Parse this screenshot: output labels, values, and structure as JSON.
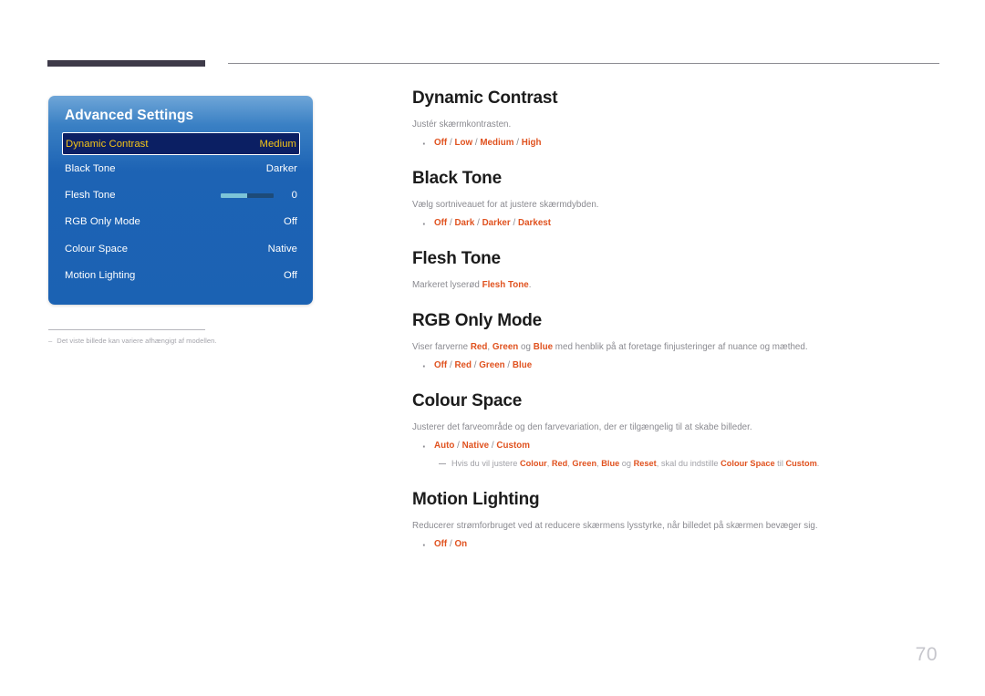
{
  "page": {
    "number": "70"
  },
  "osd": {
    "title": "Advanced Settings",
    "rows": [
      {
        "label": "Dynamic Contrast",
        "value": "Medium",
        "selected": true,
        "type": "value"
      },
      {
        "label": "Black Tone",
        "value": "Darker",
        "selected": false,
        "type": "value"
      },
      {
        "label": "Flesh Tone",
        "value": "0",
        "selected": false,
        "type": "slider",
        "slider_percent": 50
      },
      {
        "label": "RGB Only Mode",
        "value": "Off",
        "selected": false,
        "type": "value"
      },
      {
        "label": "Colour Space",
        "value": "Native",
        "selected": false,
        "type": "value"
      },
      {
        "label": "Motion Lighting",
        "value": "Off",
        "selected": false,
        "type": "value"
      }
    ]
  },
  "footnote": {
    "dash": "‒",
    "text": "Det viste billede kan variere afhængigt af modellen."
  },
  "sections": {
    "dynamic_contrast": {
      "heading": "Dynamic Contrast",
      "description": "Justér skærmkontrasten.",
      "options": [
        "Off",
        "Low",
        "Medium",
        "High"
      ]
    },
    "black_tone": {
      "heading": "Black Tone",
      "description": "Vælg sortniveauet for at justere skærmdybden.",
      "options": [
        "Off",
        "Dark",
        "Darker",
        "Darkest"
      ]
    },
    "flesh_tone": {
      "heading": "Flesh Tone",
      "desc_pre": "Markeret lyserød ",
      "desc_hl": "Flesh Tone",
      "desc_post": "."
    },
    "rgb_only_mode": {
      "heading": "RGB Only Mode",
      "desc_1": "Viser farverne ",
      "desc_hl_1": "Red",
      "desc_2": ", ",
      "desc_hl_2": "Green",
      "desc_3": " og ",
      "desc_hl_3": "Blue",
      "desc_4": " med henblik på at foretage finjusteringer af nuance og mæthed.",
      "options": [
        "Off",
        "Red",
        "Green",
        "Blue"
      ]
    },
    "colour_space": {
      "heading": "Colour Space",
      "description": "Justerer det farveområde og den farvevariation, der er tilgængelig til at skabe billeder.",
      "options": [
        "Auto",
        "Native",
        "Custom"
      ],
      "note_1": "Hvis du vil justere ",
      "note_hl_1": "Colour",
      "note_2": ", ",
      "note_hl_2": "Red",
      "note_3": ", ",
      "note_hl_3": "Green",
      "note_4": ", ",
      "note_hl_4": "Blue",
      "note_5": " og ",
      "note_hl_5": "Reset",
      "note_6": ", skal du indstille ",
      "note_hl_6": "Colour Space",
      "note_7": " til ",
      "note_hl_7": "Custom",
      "note_8": "."
    },
    "motion_lighting": {
      "heading": "Motion Lighting",
      "description": "Reducerer strømforbruget ved at reducere skærmens lysstyrke, når billedet på skærmen bevæger sig.",
      "options": [
        "Off",
        "On"
      ]
    }
  },
  "colors": {
    "accent_orange": "#e0521f",
    "osd_blue": "#1b62b3",
    "osd_selected_bg": "#0b1f63",
    "osd_selected_text": "#f5c518",
    "header_bar": "#3e3a49",
    "body_gray": "#8a8a90"
  }
}
